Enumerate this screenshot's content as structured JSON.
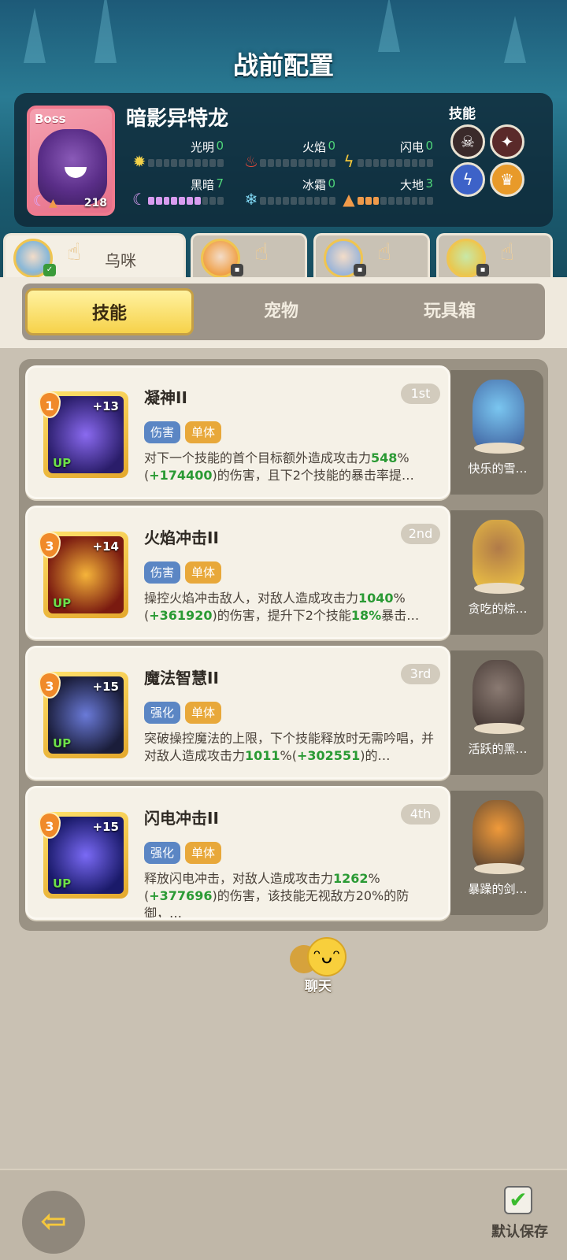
{
  "page_title": "战前配置",
  "boss": {
    "tag": "Boss",
    "name": "暗影异特龙",
    "level": "218",
    "elements": [
      {
        "label": "光明",
        "value": "0",
        "icon": "sun-icon",
        "filled": 0,
        "color": "#f4d34a"
      },
      {
        "label": "火焰",
        "value": "0",
        "icon": "flame-icon",
        "filled": 0,
        "color": "#e84a3a"
      },
      {
        "label": "闪电",
        "value": "0",
        "icon": "lightning-icon",
        "filled": 0,
        "color": "#f5c83a"
      },
      {
        "label": "黑暗",
        "value": "7",
        "icon": "moon-icon",
        "filled": 7,
        "color": "#d89cf0"
      },
      {
        "label": "冰霜",
        "value": "0",
        "icon": "snowflake-icon",
        "filled": 0,
        "color": "#7fd6f2"
      },
      {
        "label": "大地",
        "value": "3",
        "icon": "earth-icon",
        "filled": 3,
        "color": "#f09a4a"
      }
    ],
    "skills_label": "技能",
    "skills": [
      {
        "icon": "fanged-mouth-icon",
        "bg": "#3a2a2a"
      },
      {
        "icon": "red-beast-icon",
        "bg": "#3a3030"
      },
      {
        "icon": "lightning-orb-icon",
        "bg": "#3d62c8"
      },
      {
        "icon": "fire-crown-icon",
        "bg": "#e89a2a"
      }
    ]
  },
  "characters": [
    {
      "name": "乌咪",
      "active": true
    },
    {
      "name": "",
      "active": false
    },
    {
      "name": "",
      "active": false
    },
    {
      "name": "",
      "active": false
    }
  ],
  "tabs": [
    {
      "label": "技能",
      "active": true
    },
    {
      "label": "宠物",
      "active": false
    },
    {
      "label": "玩具箱",
      "active": false
    }
  ],
  "skills": [
    {
      "level": "1",
      "plus": "+13",
      "up": "UP",
      "name": "凝神II",
      "rank": "1st",
      "tags": [
        "伤害",
        "单体"
      ],
      "desc_parts": [
        "对下一个技能的首个目标额外造成攻击力",
        "548",
        "%(",
        "+174400",
        ")的伤害，且下2个技能的暴击率提",
        "",
        "…",
        ""
      ],
      "icon_colors": [
        "#2a1d6a",
        "#8a6af0"
      ],
      "pet_name": "快乐的雪…",
      "pet_colors": [
        "#7ac6f0",
        "#3c5b9a"
      ]
    },
    {
      "level": "3",
      "plus": "+14",
      "up": "UP",
      "name": "火焰冲击II",
      "rank": "2nd",
      "tags": [
        "伤害",
        "单体"
      ],
      "desc_parts": [
        "操控火焰冲击敌人，对敌人造成攻击力",
        "1040",
        "%(",
        "+361920",
        ")的伤害，提升下2个技能",
        "18%",
        "暴击…",
        ""
      ],
      "icon_colors": [
        "#7a1a10",
        "#f5b43a"
      ],
      "pet_name": "贪吃的棕…",
      "pet_colors": [
        "#b07a48",
        "#f2c844"
      ]
    },
    {
      "level": "3",
      "plus": "+15",
      "up": "UP",
      "name": "魔法智慧II",
      "rank": "3rd",
      "tags": [
        "强化",
        "单体"
      ],
      "desc_parts": [
        "突破操控魔法的上限，下个技能释放时无需吟唱，并对敌人造成攻击力",
        "1011",
        "%(",
        "+302551",
        ")的…",
        "",
        "",
        ""
      ],
      "icon_colors": [
        "#1a1d3a",
        "#6a7ad8"
      ],
      "pet_name": "活跃的黑…",
      "pet_colors": [
        "#8a7a72",
        "#3a2e2a"
      ]
    },
    {
      "level": "3",
      "plus": "+15",
      "up": "UP",
      "name": "闪电冲击II",
      "rank": "4th",
      "tags": [
        "强化",
        "单体"
      ],
      "desc_parts": [
        "释放闪电冲击，对敌人造成攻击力",
        "1262",
        "%(",
        "+377696",
        ")的伤害，该技能无视敌方20%的防御，…",
        "",
        "",
        ""
      ],
      "icon_colors": [
        "#1a1a6a",
        "#7a6af5"
      ],
      "pet_name": "暴躁的剑…",
      "pet_colors": [
        "#f09a3a",
        "#4a3a30"
      ]
    }
  ],
  "chat_label": "聊天",
  "save_label": "默认保存"
}
